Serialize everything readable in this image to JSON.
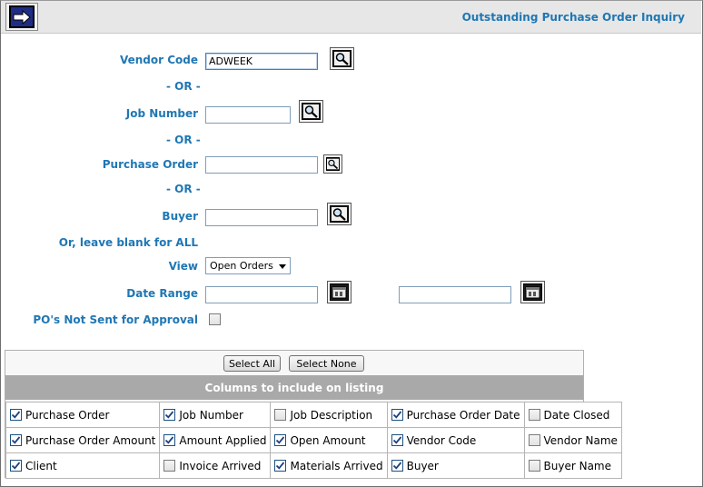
{
  "header": {
    "title": "Outstanding Purchase Order Inquiry",
    "go_icon": "arrow-right-icon"
  },
  "form": {
    "vendor_code_label": "Vendor Code",
    "vendor_code_value": "ADWEEK",
    "or_1": "- OR -",
    "job_number_label": "Job Number",
    "job_number_value": "",
    "or_2": "- OR -",
    "purchase_order_label": "Purchase Order",
    "purchase_order_value": "",
    "or_3": "- OR -",
    "buyer_label": "Buyer",
    "buyer_value": "",
    "blank_note": "Or, leave blank for ALL",
    "view_label": "View",
    "view_selected": "Open Orders",
    "date_range_label": "Date Range",
    "date_from_value": "",
    "date_to_value": "",
    "po_not_sent_label": "PO's Not Sent for Approval",
    "po_not_sent_checked": false
  },
  "columns_panel": {
    "select_all_label": "Select All",
    "select_none_label": "Select None",
    "header": "Columns to include on listing",
    "rows": [
      [
        {
          "label": "Purchase Order",
          "checked": true
        },
        {
          "label": "Job Number",
          "checked": true
        },
        {
          "label": "Job Description",
          "checked": false
        },
        {
          "label": "Purchase Order Date",
          "checked": true
        },
        {
          "label": "Date Closed",
          "checked": false
        }
      ],
      [
        {
          "label": "Purchase Order Amount",
          "checked": true
        },
        {
          "label": "Amount Applied",
          "checked": true
        },
        {
          "label": "Open Amount",
          "checked": true
        },
        {
          "label": "Vendor Code",
          "checked": true
        },
        {
          "label": "Vendor Name",
          "checked": false
        }
      ],
      [
        {
          "label": "Client",
          "checked": true
        },
        {
          "label": "Invoice Arrived",
          "checked": false
        },
        {
          "label": "Materials Arrived",
          "checked": true
        },
        {
          "label": "Buyer",
          "checked": true
        },
        {
          "label": "Buyer Name",
          "checked": false
        }
      ]
    ]
  },
  "colors": {
    "label_blue": "#1f77b4",
    "header_gray": "#a9a9a9",
    "go_button_blue": "#1f2c86"
  }
}
